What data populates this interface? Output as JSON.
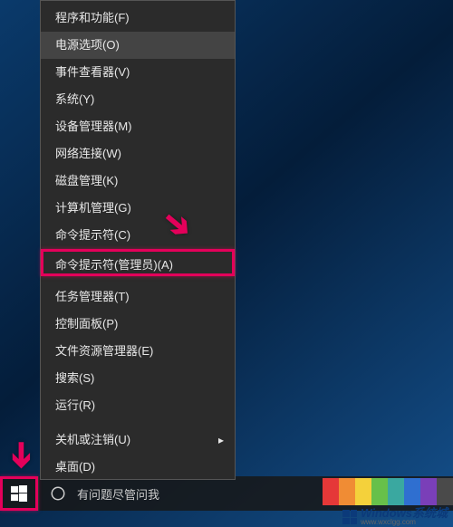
{
  "menu": {
    "items": [
      {
        "label": "程序和功能(F)",
        "bind": "menu.items.0.label"
      },
      {
        "label": "电源选项(O)",
        "bind": "menu.items.1.label"
      },
      {
        "label": "事件查看器(V)",
        "bind": "menu.items.2.label"
      },
      {
        "label": "系统(Y)",
        "bind": "menu.items.3.label"
      },
      {
        "label": "设备管理器(M)",
        "bind": "menu.items.4.label"
      },
      {
        "label": "网络连接(W)",
        "bind": "menu.items.5.label"
      },
      {
        "label": "磁盘管理(K)",
        "bind": "menu.items.6.label"
      },
      {
        "label": "计算机管理(G)",
        "bind": "menu.items.7.label"
      },
      {
        "label": "命令提示符(C)",
        "bind": "menu.items.8.label"
      },
      {
        "label": "命令提示符(管理员)(A)",
        "bind": "menu.items.9.label"
      },
      {
        "label": "任务管理器(T)",
        "bind": "menu.items.10.label"
      },
      {
        "label": "控制面板(P)",
        "bind": "menu.items.11.label"
      },
      {
        "label": "文件资源管理器(E)",
        "bind": "menu.items.12.label"
      },
      {
        "label": "搜索(S)",
        "bind": "menu.items.13.label"
      },
      {
        "label": "运行(R)",
        "bind": "menu.items.14.label"
      },
      {
        "label": "关机或注销(U)",
        "bind": "menu.items.15.label"
      },
      {
        "label": "桌面(D)",
        "bind": "menu.items.16.label"
      }
    ],
    "highlighted_index": 9,
    "hover_index": 1
  },
  "taskbar": {
    "search_placeholder": "有问题尽管问我"
  },
  "annotation": {
    "highlight_color": "#e4005a"
  },
  "swatches": [
    "#e53838",
    "#f08c34",
    "#f4d13b",
    "#67c04a",
    "#3aa8a0",
    "#2f6fd0",
    "#7a3fb8",
    "#4a4a4a"
  ],
  "watermark": {
    "title": "Windows系统城",
    "url": "www.wxclgg.com"
  }
}
